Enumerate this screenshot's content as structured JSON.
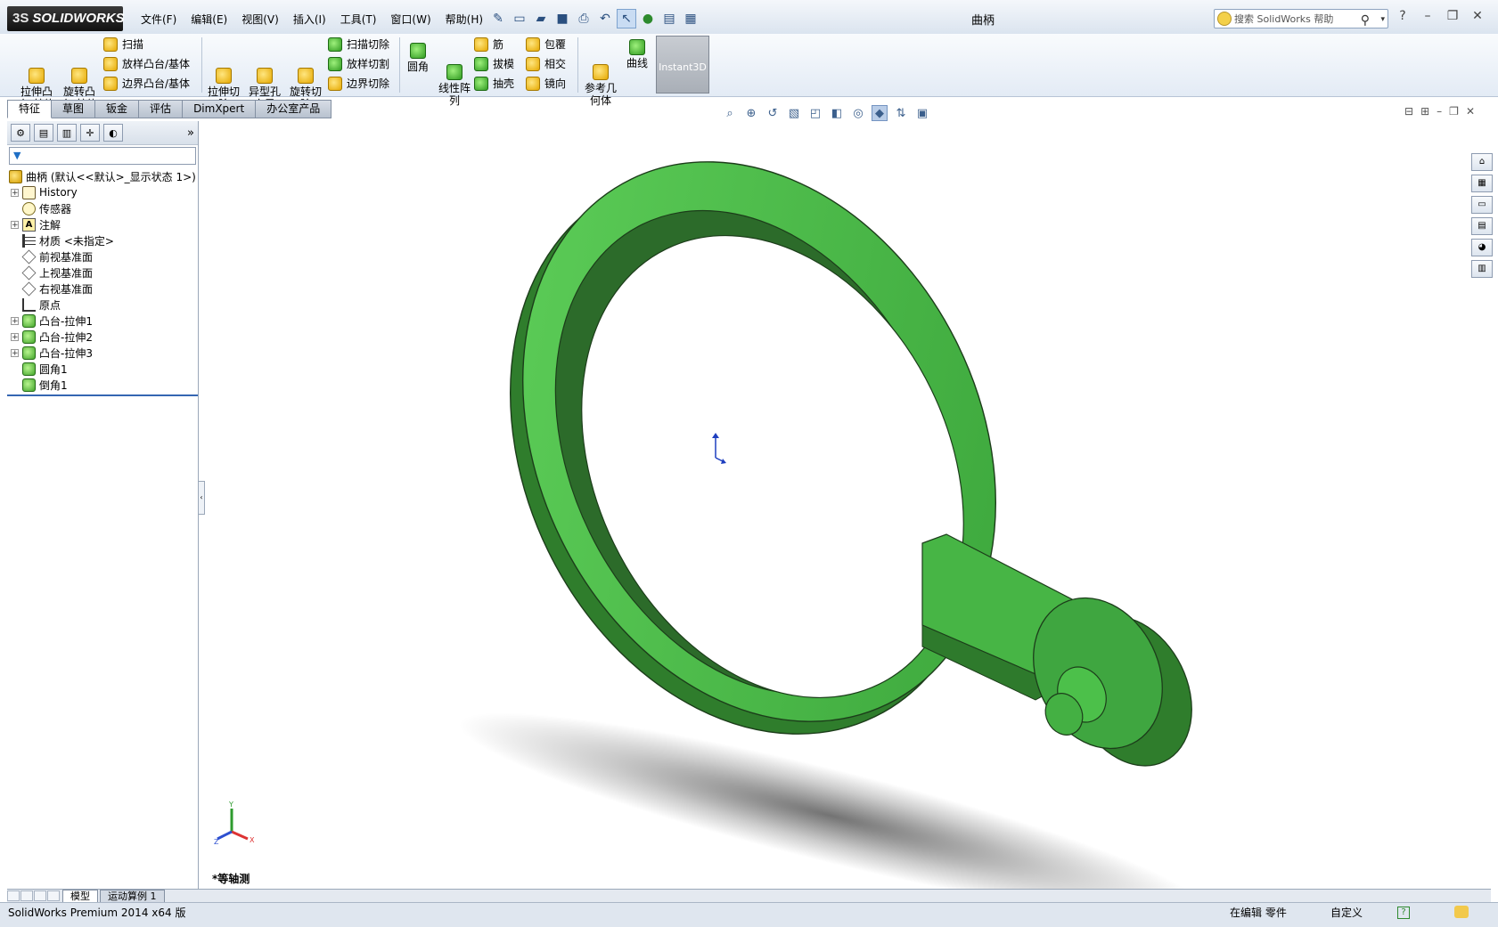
{
  "app": {
    "logo_text": "SOLIDWORKS",
    "logo_mark": "3S",
    "doc_title": "曲柄"
  },
  "menu": [
    "文件(F)",
    "编辑(E)",
    "视图(V)",
    "插入(I)",
    "工具(T)",
    "窗口(W)",
    "帮助(H)"
  ],
  "quick_access_icons": [
    "pin-icon",
    "new-doc-icon",
    "open-icon",
    "save-icon",
    "print-icon",
    "undo-icon",
    "select-icon",
    "rebuild-icon",
    "file-props-icon",
    "options-icon"
  ],
  "search": {
    "placeholder": "搜索 SolidWorks 帮助"
  },
  "ribbon": {
    "extrude_boss": "拉伸凸\n台/基体",
    "revolve_boss": "旋转凸\n台/基体",
    "sweep": "扫描",
    "loft_boss": "放样凸台/基体",
    "boundary_boss": "边界凸台/基体",
    "extrude_cut": "拉伸切\n除",
    "hole_wizard": "异型孔\n向导",
    "revolve_cut": "旋转切\n除",
    "swept_cut": "扫描切除",
    "lofted_cut": "放样切割",
    "boundary_cut": "边界切除",
    "fillet": "圆角",
    "linear_pattern": "线性阵\n列",
    "rib": "筋",
    "draft": "拔模",
    "shell": "抽壳",
    "wrap": "包覆",
    "intersect": "相交",
    "mirror": "镜向",
    "ref_geometry": "参考几\n何体",
    "curves": "曲线",
    "instant3d": "Instant3D"
  },
  "tabs": [
    "特征",
    "草图",
    "钣金",
    "评估",
    "DimXpert",
    "办公室产品"
  ],
  "active_tab": "特征",
  "tree": {
    "root": "曲柄 (默认<<默认>_显示状态 1>)",
    "items": [
      {
        "label": "History",
        "icon": "history-icon",
        "expandable": true
      },
      {
        "label": "传感器",
        "icon": "sensor-icon",
        "expandable": false
      },
      {
        "label": "注解",
        "icon": "annotation-icon",
        "expandable": true
      },
      {
        "label": "材质 <未指定>",
        "icon": "material-icon",
        "expandable": false
      },
      {
        "label": "前视基准面",
        "icon": "plane-icon",
        "expandable": false
      },
      {
        "label": "上视基准面",
        "icon": "plane-icon",
        "expandable": false
      },
      {
        "label": "右视基准面",
        "icon": "plane-icon",
        "expandable": false
      },
      {
        "label": "原点",
        "icon": "origin-icon",
        "expandable": false
      },
      {
        "label": "凸台-拉伸1",
        "icon": "extrude-icon",
        "expandable": true
      },
      {
        "label": "凸台-拉伸2",
        "icon": "extrude-icon",
        "expandable": true
      },
      {
        "label": "凸台-拉伸3",
        "icon": "extrude-icon",
        "expandable": true
      },
      {
        "label": "圆角1",
        "icon": "fillet-icon",
        "expandable": false
      },
      {
        "label": "倒角1",
        "icon": "chamfer-icon",
        "expandable": false
      }
    ]
  },
  "viewport": {
    "view_name": "*等轴测",
    "model_color": "#3fa640",
    "triad_labels": {
      "x": "X",
      "y": "Y",
      "z": "Z"
    }
  },
  "bottom_tabs": [
    "模型",
    "运动算例 1"
  ],
  "status": {
    "left": "SolidWorks Premium 2014 x64 版",
    "mode": "在编辑 零件",
    "custom": "自定义",
    "help": "?"
  }
}
